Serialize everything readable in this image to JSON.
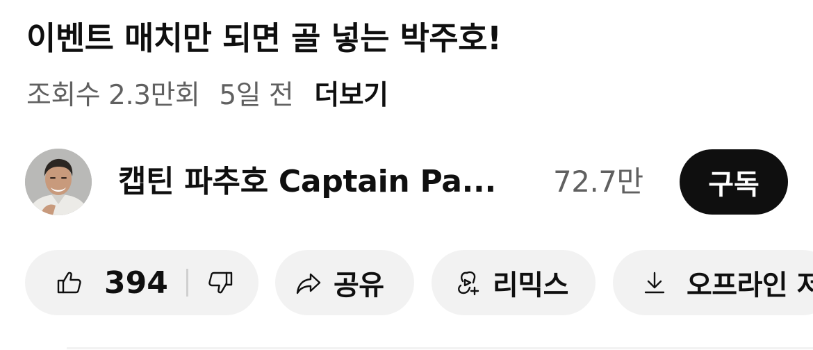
{
  "video": {
    "title": "이벤트 매치만 되면 골 넣는 박주호!",
    "views": "조회수 2.3만회",
    "time": "5일 전",
    "more": "더보기"
  },
  "channel": {
    "name": "캡틴 파추호 Captain Pa...",
    "subscribers": "72.7만",
    "subscribe_label": "구독"
  },
  "actions": {
    "like_count": "394",
    "share_label": "공유",
    "remix_label": "리믹스",
    "offline_label": "오프라인 저"
  },
  "icons": {
    "like": "thumbs-up-icon",
    "dislike": "thumbs-down-icon",
    "share": "share-arrow-icon",
    "remix": "remix-icon",
    "download": "download-icon"
  },
  "colors": {
    "background": "#ffffff",
    "text": "#0f0f0f",
    "secondary_text": "#606060",
    "pill_background": "#f2f2f2",
    "subscribe_background": "#0f0f0f",
    "subscribe_text": "#ffffff"
  }
}
